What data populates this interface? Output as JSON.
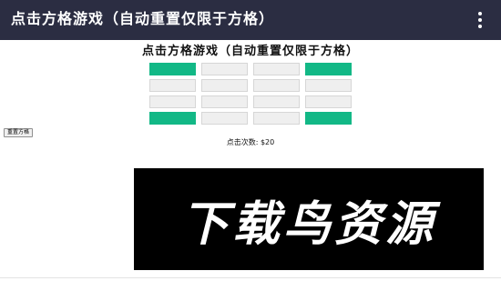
{
  "header": {
    "title": "点击方格游戏（自动重置仅限于方格）",
    "menu_icon": "more-vert-icon"
  },
  "game": {
    "title": "点击方格游戏（自动重置仅限于方格）",
    "grid": [
      [
        true,
        false,
        false,
        true
      ],
      [
        false,
        false,
        false,
        false
      ],
      [
        false,
        false,
        false,
        false
      ],
      [
        true,
        false,
        false,
        true
      ]
    ],
    "reset_label": "重置方格",
    "click_count": "点击次数: $20"
  },
  "watermark": {
    "text": "下载鸟资源"
  },
  "colors": {
    "header_bg": "#2b2d42",
    "cell_on": "#12b886",
    "cell_off": "#efefef"
  }
}
